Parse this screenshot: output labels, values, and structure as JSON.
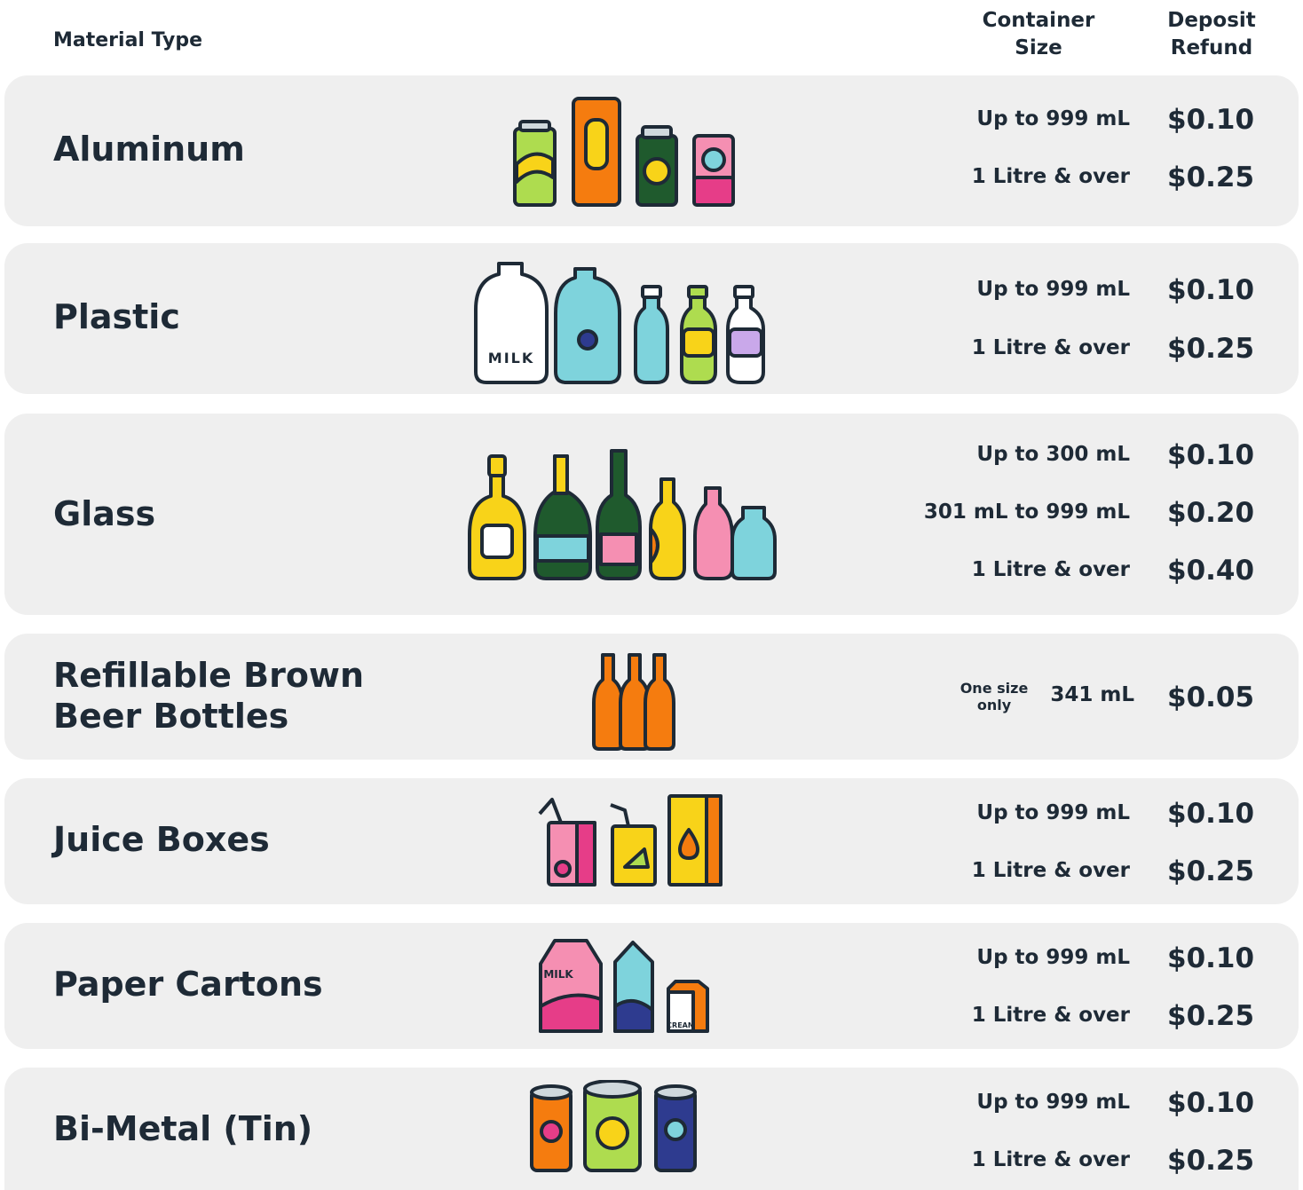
{
  "header": {
    "material": "Material Type",
    "size": "Container\nSize",
    "refund": "Deposit\nRefund"
  },
  "rows": [
    {
      "material": "Aluminum",
      "tiers": [
        {
          "size": "Up to 999 mL",
          "price": "$0.10"
        },
        {
          "size": "1 Litre & over",
          "price": "$0.25"
        }
      ]
    },
    {
      "material": "Plastic",
      "illustration_text": "MILK",
      "tiers": [
        {
          "size": "Up to 999 mL",
          "price": "$0.10"
        },
        {
          "size": "1 Litre & over",
          "price": "$0.25"
        }
      ]
    },
    {
      "material": "Glass",
      "tiers": [
        {
          "size": "Up to 300 mL",
          "price": "$0.10"
        },
        {
          "size": "301 mL to 999 mL",
          "price": "$0.20"
        },
        {
          "size": "1 Litre & over",
          "price": "$0.40"
        }
      ]
    },
    {
      "material": "Refillable Brown\nBeer Bottles",
      "note": "One size\nonly",
      "tiers": [
        {
          "size": "341 mL",
          "price": "$0.05"
        }
      ]
    },
    {
      "material": "Juice Boxes",
      "tiers": [
        {
          "size": "Up to 999 mL",
          "price": "$0.10"
        },
        {
          "size": "1 Litre & over",
          "price": "$0.25"
        }
      ]
    },
    {
      "material": "Paper Cartons",
      "illustration_text": [
        "MILK",
        "CREAM"
      ],
      "tiers": [
        {
          "size": "Up to 999 mL",
          "price": "$0.10"
        },
        {
          "size": "1 Litre & over",
          "price": "$0.25"
        }
      ]
    },
    {
      "material": "Bi-Metal (Tin)",
      "tiers": [
        {
          "size": "Up to 999 mL",
          "price": "$0.10"
        },
        {
          "size": "1 Litre & over",
          "price": "$0.25"
        }
      ]
    }
  ],
  "colors": {
    "row_bg": "#efefef",
    "text": "#1e2a36",
    "orange": "#f57c0f",
    "yellow": "#f8d319",
    "lime": "#aedc4f",
    "pink": "#e63d88",
    "teal": "#7ed3dc",
    "green": "#1f5a2d",
    "navy": "#2e3b8f"
  }
}
